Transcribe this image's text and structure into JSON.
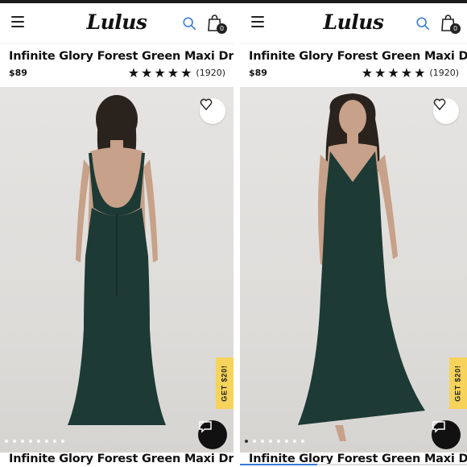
{
  "brand": "Lulus",
  "colors": {
    "accent": "#3a7bd5",
    "promo": "#f6d35a",
    "dress": "#1d3a35"
  },
  "panels": [
    {
      "title": "Infinite Glory Forest Green Maxi Dress",
      "price": "$89",
      "stars": "★★★★★",
      "review_count": "(1920)",
      "cart_count": "0",
      "promo": "GET $20!",
      "bottom_title": "Infinite Glory Forest Green Maxi Dress",
      "view": "back",
      "carousel_dots": 8,
      "active_dot": 6
    },
    {
      "title": "Infinite Glory Forest Green Maxi Dress",
      "price": "$89",
      "stars": "★★★★★",
      "review_count": "(1920)",
      "cart_count": "0",
      "promo": "GET $20!",
      "bottom_title": "Infinite Glory Forest Green Maxi Dress",
      "view": "front",
      "carousel_dots": 8,
      "active_dot": 1,
      "progress": 0.34
    }
  ],
  "icons": [
    "menu-icon",
    "search-icon",
    "shopping-bag-icon",
    "heart-icon",
    "chat-icon"
  ]
}
